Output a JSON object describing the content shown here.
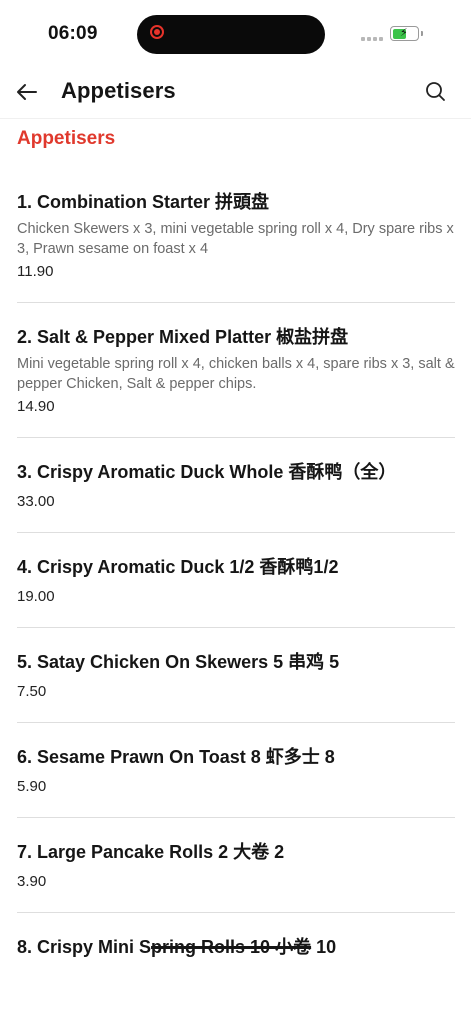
{
  "status_bar": {
    "time": "06:09"
  },
  "header": {
    "title": "Appetisers"
  },
  "section": {
    "title": "Appetisers"
  },
  "colors": {
    "accent": "#e0392d",
    "battery": "#3cc34a"
  },
  "items": [
    {
      "name": "1. Combination Starter 拼頭盘",
      "description": "Chicken Skewers x 3, mini vegetable spring roll x 4, Dry spare ribs x 3, Prawn sesame on foast x 4",
      "price": "11.90"
    },
    {
      "name": "2. Salt & Pepper Mixed Platter 椒盐拼盘",
      "description": "Mini vegetable spring roll x 4, chicken balls x 4, spare ribs x 3, salt & pepper Chicken, Salt & pepper chips.",
      "price": "14.90"
    },
    {
      "name": "3. Crispy Aromatic Duck Whole 香酥鸭（全）",
      "description": "",
      "price": "33.00"
    },
    {
      "name": "4. Crispy Aromatic Duck 1/2 香酥鸭1/2",
      "description": "",
      "price": "19.00"
    },
    {
      "name": "5. Satay Chicken On Skewers 5 串鸡 5",
      "description": "",
      "price": "7.50"
    },
    {
      "name": "6. Sesame Prawn On Toast 8 虾多士 8",
      "description": "",
      "price": "5.90"
    },
    {
      "name": "7. Large Pancake Rolls 2 大卷 2",
      "description": "",
      "price": "3.90"
    },
    {
      "name_prefix": "8. Crispy Mini S",
      "name_struck": "pring Rolls 10 小卷",
      "name_suffix": " 10",
      "description": "",
      "price": ""
    }
  ],
  "icons": {
    "back": "arrow-left-icon",
    "search": "search-icon",
    "record": "record-icon",
    "signal": "signal-icon",
    "battery": "battery-charging-icon"
  }
}
